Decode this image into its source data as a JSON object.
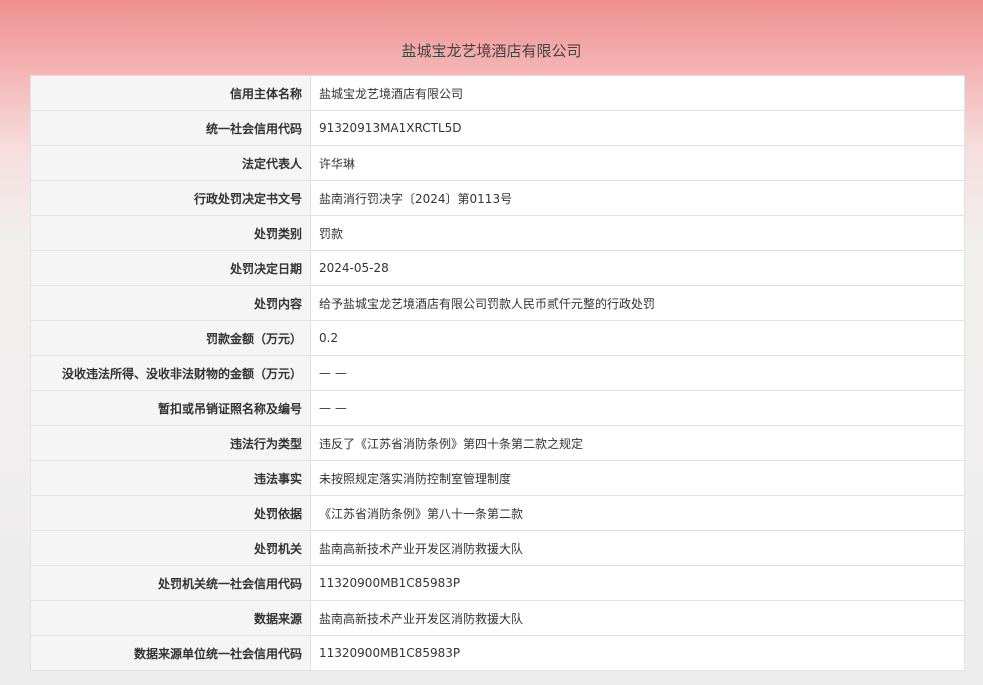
{
  "page_title": "盐城宝龙艺境酒店有限公司",
  "rows": [
    {
      "label": "信用主体名称",
      "value": "盐城宝龙艺境酒店有限公司"
    },
    {
      "label": "统一社会信用代码",
      "value": "91320913MA1XRCTL5D"
    },
    {
      "label": "法定代表人",
      "value": "许华琳"
    },
    {
      "label": "行政处罚决定书文号",
      "value": "盐南消行罚决字〔2024〕第0113号"
    },
    {
      "label": "处罚类别",
      "value": "罚款"
    },
    {
      "label": "处罚决定日期",
      "value": "2024-05-28"
    },
    {
      "label": "处罚内容",
      "value": "给予盐城宝龙艺境酒店有限公司罚款人民币贰仟元整的行政处罚"
    },
    {
      "label": "罚款金额（万元）",
      "value": "0.2"
    },
    {
      "label": "没收违法所得、没收非法财物的金额（万元）",
      "value": "— —"
    },
    {
      "label": "暂扣或吊销证照名称及编号",
      "value": "— —"
    },
    {
      "label": "违法行为类型",
      "value": "违反了《江苏省消防条例》第四十条第二款之规定"
    },
    {
      "label": "违法事实",
      "value": "未按照规定落实消防控制室管理制度"
    },
    {
      "label": "处罚依据",
      "value": "《江苏省消防条例》第八十一条第二款"
    },
    {
      "label": "处罚机关",
      "value": "盐南高新技术产业开发区消防救援大队"
    },
    {
      "label": "处罚机关统一社会信用代码",
      "value": "11320900MB1C85983P"
    },
    {
      "label": "数据来源",
      "value": "盐南高新技术产业开发区消防救援大队"
    },
    {
      "label": "数据来源单位统一社会信用代码",
      "value": "11320900MB1C85983P"
    }
  ]
}
